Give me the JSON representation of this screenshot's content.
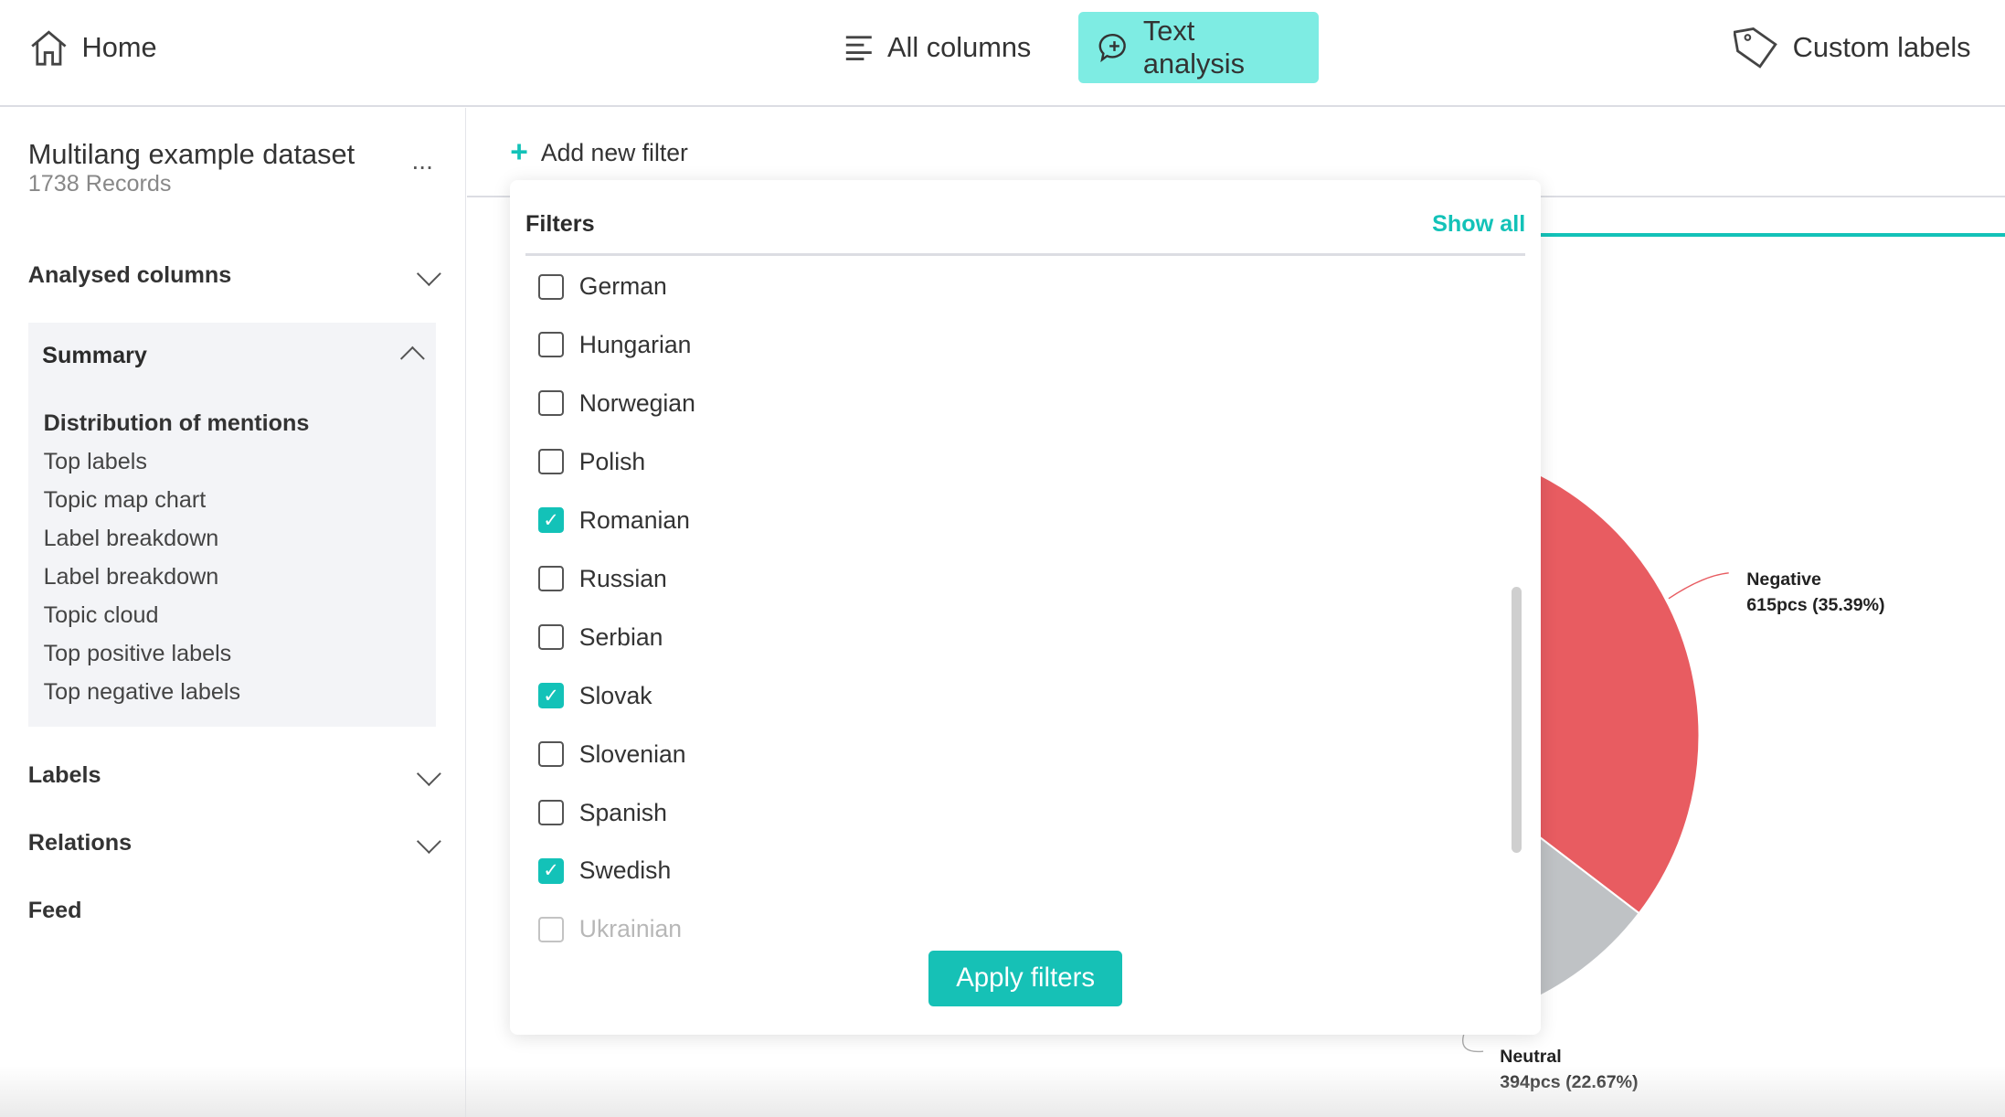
{
  "topbar": {
    "home": "Home",
    "all_columns": "All columns",
    "text_analysis": "Text analysis",
    "custom_labels": "Custom labels",
    "accent": "#7eece3"
  },
  "sidebar": {
    "dataset_title": "Multilang example dataset",
    "records": "1738 Records",
    "more": "...",
    "analysed_columns": "Analysed columns",
    "summary": "Summary",
    "summary_items": [
      "Distribution of mentions",
      "Top labels",
      "Topic map chart",
      "Label breakdown",
      "Label breakdown",
      "Topic cloud",
      "Top positive labels",
      "Top negative labels"
    ],
    "labels": "Labels",
    "relations": "Relations",
    "feed": "Feed"
  },
  "main": {
    "add_filter": "Add new filter"
  },
  "filters": {
    "title": "Filters",
    "show_all": "Show all",
    "apply": "Apply filters",
    "options": [
      {
        "label": "German",
        "checked": false
      },
      {
        "label": "Hungarian",
        "checked": false
      },
      {
        "label": "Norwegian",
        "checked": false
      },
      {
        "label": "Polish",
        "checked": false
      },
      {
        "label": "Romanian",
        "checked": true
      },
      {
        "label": "Russian",
        "checked": false
      },
      {
        "label": "Serbian",
        "checked": false
      },
      {
        "label": "Slovak",
        "checked": true
      },
      {
        "label": "Slovenian",
        "checked": false
      },
      {
        "label": "Spanish",
        "checked": false
      },
      {
        "label": "Swedish",
        "checked": true
      },
      {
        "label": "Ukrainian",
        "checked": false
      }
    ]
  },
  "chart_data": {
    "type": "pie",
    "slices": [
      {
        "name": "Negative",
        "count": 615,
        "percent": 35.39,
        "label": "615pcs (35.39%)",
        "color": "#e85c61"
      },
      {
        "name": "Neutral",
        "count": 394,
        "percent": 22.67,
        "label": "394pcs (22.67%)",
        "color": "#bfc2c5"
      }
    ]
  }
}
